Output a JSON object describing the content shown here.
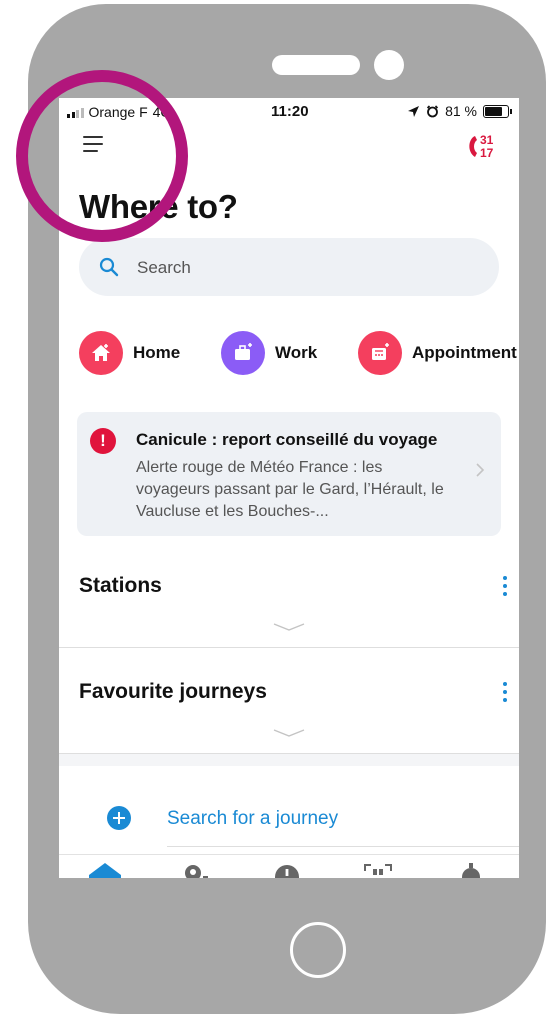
{
  "status_bar": {
    "carrier": "Orange F",
    "network": "4G",
    "time": "11:20",
    "battery": "81 %"
  },
  "header": {
    "menu_icon": "hamburger-menu-icon",
    "helpline_numbers": [
      "31",
      "17"
    ],
    "helpline_color": "#d9183f"
  },
  "title": "Where to?",
  "search": {
    "placeholder": "Search"
  },
  "shortcuts": [
    {
      "label": "Home",
      "icon": "home-icon",
      "color": "#f43f5e"
    },
    {
      "label": "Work",
      "icon": "briefcase-icon",
      "color": "#8b5cf6"
    },
    {
      "label": "Appointment",
      "icon": "calendar-icon",
      "color": "#f43f5e"
    }
  ],
  "alert": {
    "title": "Canicule : report conseillé du voyage",
    "body": "Alerte rouge de Météo France : les voyageurs passant par le Gard, l’Hérault, le Vaucluse et les Bouches-...",
    "color": "#e0143c"
  },
  "sections": {
    "stations": "Stations",
    "favourites": "Favourite journeys"
  },
  "journey_link": "Search for a journey",
  "colors": {
    "accent": "#1a8ad4",
    "highlight": "#b2167c",
    "phone_frame": "#a7a7a7"
  }
}
